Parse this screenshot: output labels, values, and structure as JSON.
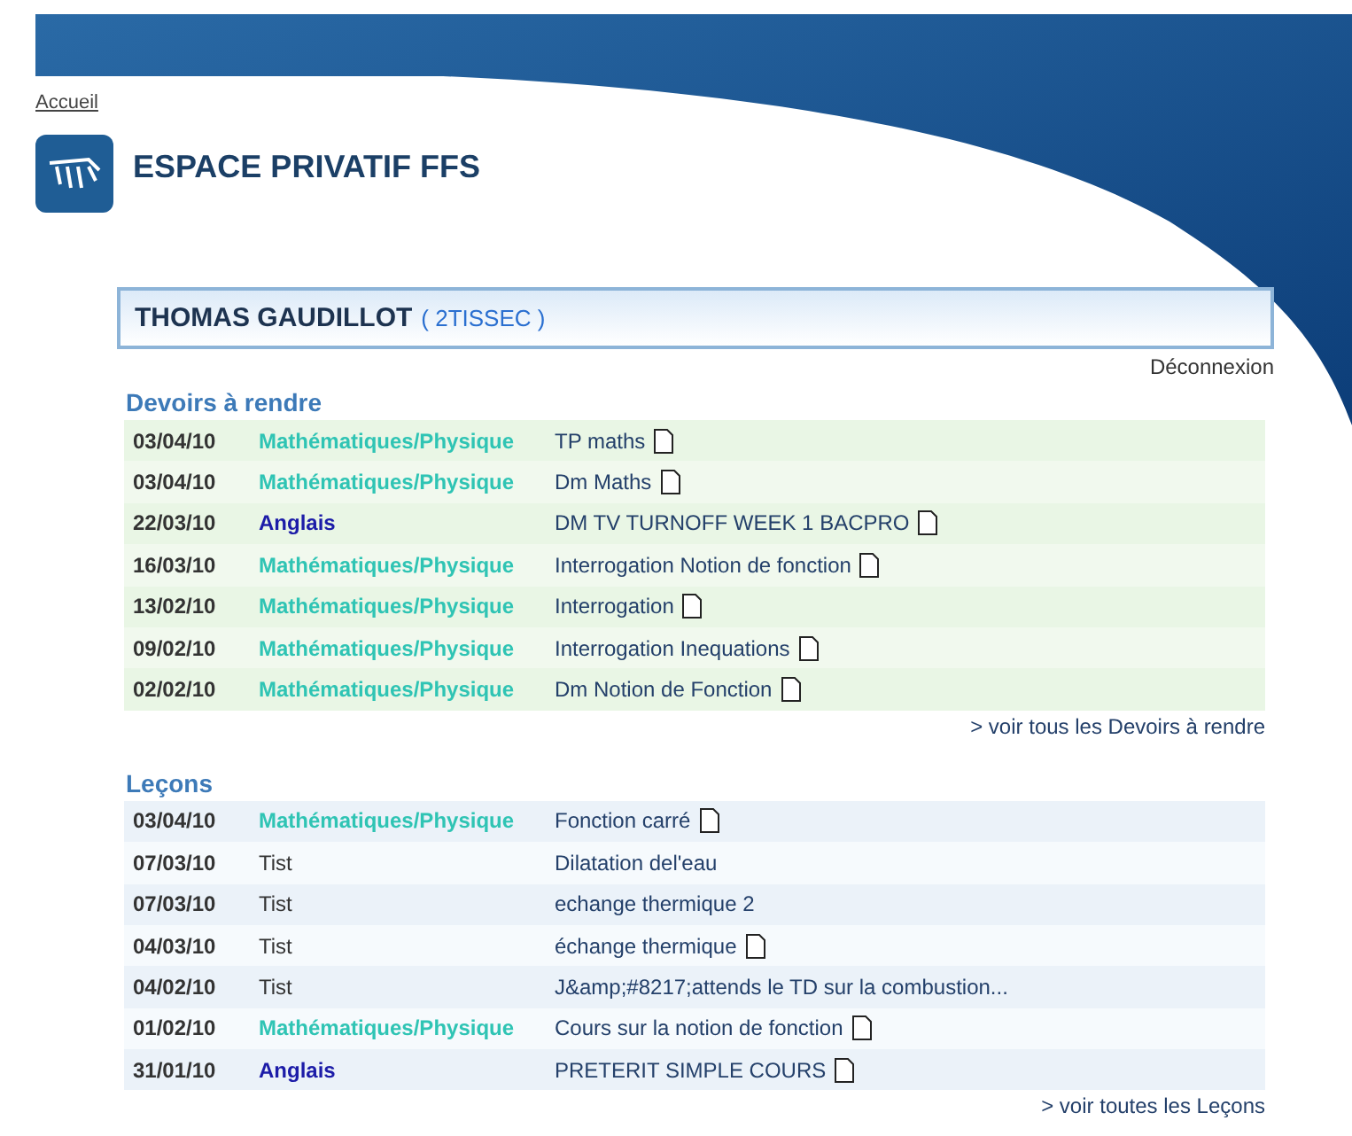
{
  "nav": {
    "home_link": "Accueil"
  },
  "header": {
    "title": "ESPACE PRIVATIF FFS"
  },
  "student": {
    "name": "THOMAS GAUDILLOT",
    "class": "( 2TISSEC )",
    "logout": "Déconnexion"
  },
  "sections": [
    {
      "kind": "devoirs",
      "title": "Devoirs à rendre",
      "more_link": "> voir tous les Devoirs à rendre",
      "rows": [
        {
          "date": "03/04/10",
          "subject": "Mathématiques/Physique",
          "color": "#2fc4b4",
          "bold": true,
          "title": "TP maths",
          "has_document": true
        },
        {
          "date": "03/04/10",
          "subject": "Mathématiques/Physique",
          "color": "#2fc4b4",
          "bold": true,
          "title": "Dm Maths",
          "has_document": true
        },
        {
          "date": "22/03/10",
          "subject": "Anglais",
          "color": "#1c1ca8",
          "bold": true,
          "title": "DM TV TURNOFF WEEK 1 BACPRO",
          "has_document": true
        },
        {
          "date": "16/03/10",
          "subject": "Mathématiques/Physique",
          "color": "#2fc4b4",
          "bold": true,
          "title": "Interrogation Notion de fonction",
          "has_document": true
        },
        {
          "date": "13/02/10",
          "subject": "Mathématiques/Physique",
          "color": "#2fc4b4",
          "bold": true,
          "title": "Interrogation",
          "has_document": true
        },
        {
          "date": "09/02/10",
          "subject": "Mathématiques/Physique",
          "color": "#2fc4b4",
          "bold": true,
          "title": "Interrogation Inequations",
          "has_document": true
        },
        {
          "date": "02/02/10",
          "subject": "Mathématiques/Physique",
          "color": "#2fc4b4",
          "bold": true,
          "title": "Dm Notion de Fonction",
          "has_document": true
        }
      ]
    },
    {
      "kind": "lecons",
      "title": "Leçons",
      "more_link": "> voir toutes les Leçons",
      "rows": [
        {
          "date": "03/04/10",
          "subject": "Mathématiques/Physique",
          "color": "#2fc4b4",
          "bold": true,
          "title": "Fonction carré",
          "has_document": true
        },
        {
          "date": "07/03/10",
          "subject": "Tist",
          "color": "#333333",
          "bold": false,
          "title": "Dilatation del'eau",
          "has_document": false
        },
        {
          "date": "07/03/10",
          "subject": "Tist",
          "color": "#333333",
          "bold": false,
          "title": "echange thermique 2",
          "has_document": false
        },
        {
          "date": "04/03/10",
          "subject": "Tist",
          "color": "#333333",
          "bold": false,
          "title": "échange thermique",
          "has_document": true
        },
        {
          "date": "04/02/10",
          "subject": "Tist",
          "color": "#333333",
          "bold": false,
          "title": "J&amp;#8217;attends le TD sur la combustion...",
          "has_document": false
        },
        {
          "date": "01/02/10",
          "subject": "Mathématiques/Physique",
          "color": "#2fc4b4",
          "bold": true,
          "title": "Cours sur la notion de fonction",
          "has_document": true
        },
        {
          "date": "31/01/10",
          "subject": "Anglais",
          "color": "#1c1ca8",
          "bold": true,
          "title": "PRETERIT SIMPLE COURS",
          "has_document": true
        }
      ]
    }
  ]
}
